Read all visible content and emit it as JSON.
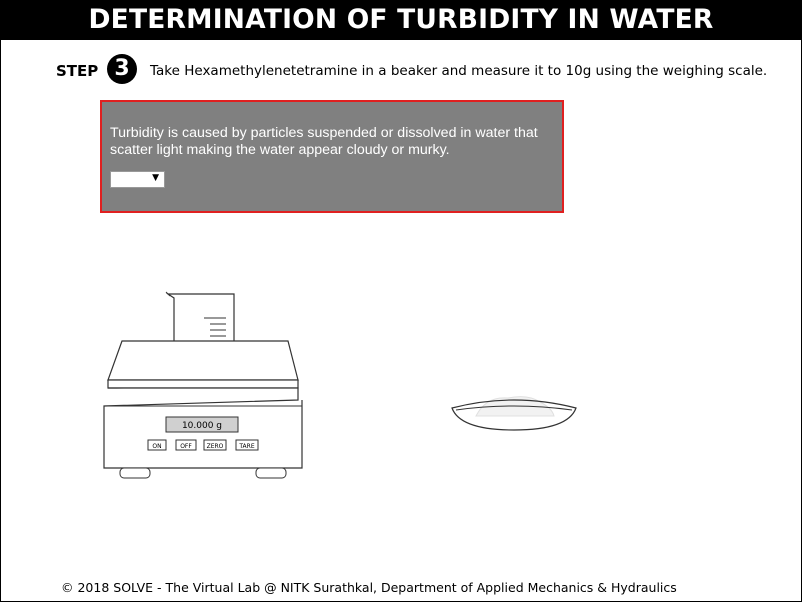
{
  "header": {
    "title": "DETERMINATION OF TURBIDITY IN WATER"
  },
  "step": {
    "label": "STEP",
    "number": "3",
    "instruction": "Take Hexamethylenetetramine in a beaker and measure it to 10g using the weighing scale."
  },
  "info_box": {
    "text": "Turbidity is caused by particles suspended or dissolved in water that scatter light making the water appear cloudy or murky.",
    "dropdown_value": "",
    "border_color": "#e02020",
    "background_color": "#808080"
  },
  "scale": {
    "display": "10.000 g",
    "buttons": [
      "ON",
      "OFF",
      "ZERO",
      "TARE"
    ]
  },
  "footer": {
    "text": "© 2018 SOLVE - The Virtual Lab @ NITK Surathkal, Department of Applied Mechanics & Hydraulics"
  }
}
